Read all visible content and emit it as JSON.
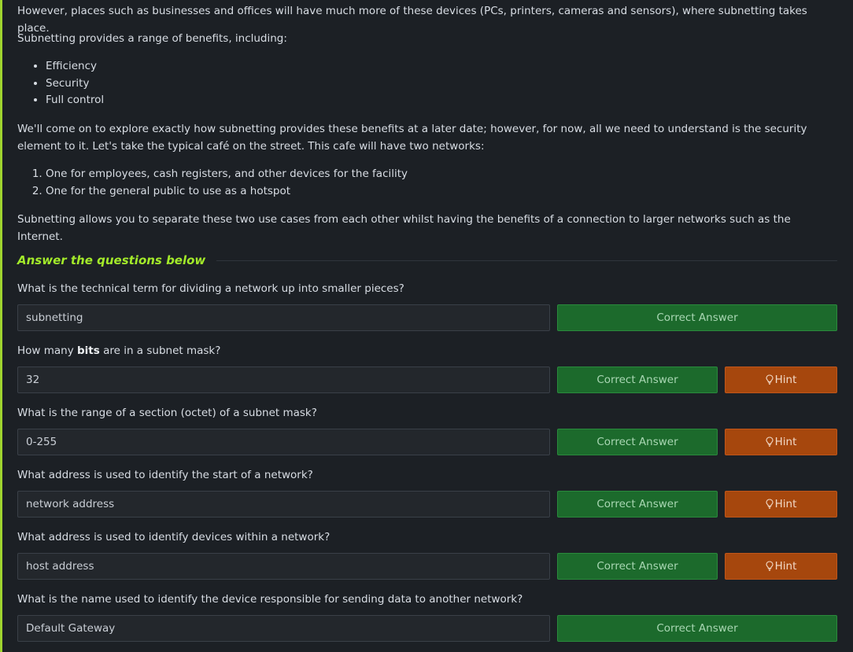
{
  "intro": {
    "p1": "However, places such as businesses and offices will have much more of these devices (PCs, printers, cameras and sensors), where subnetting takes place.",
    "p2": "Subnetting provides a range of benefits, including:",
    "benefits": [
      "Efficiency",
      "Security",
      "Full control"
    ],
    "p3": "We'll come on to explore exactly how subnetting provides these benefits at a later date; however, for now, all we need to understand is the security element to it. Let's take the typical café on the street. This cafe will have two networks:",
    "networks": [
      "One for employees, cash registers, and other devices for the facility",
      "One for the general public to use as a hotspot"
    ],
    "p4": "Subnetting allows you to separate these two use cases from each other whilst having the benefits of a connection to larger networks such as the Internet."
  },
  "answers_section": {
    "title": "Answer the questions below",
    "questions": [
      {
        "question": "What is the technical term for dividing a network up into smaller pieces?",
        "answer": "subnetting",
        "button": "Correct Answer",
        "hint": null
      },
      {
        "question_pre": "How many ",
        "question_bold": "bits",
        "question_post": " are in a subnet mask?",
        "answer": "32",
        "button": "Correct Answer",
        "hint": "Hint"
      },
      {
        "question": "What is the range of a section (octet) of a subnet mask?",
        "answer": "0-255",
        "button": "Correct Answer",
        "hint": "Hint"
      },
      {
        "question": "What address is used to identify the start of a network?",
        "answer": "network address",
        "button": "Correct Answer",
        "hint": "Hint"
      },
      {
        "question": "What address is used to identify devices within a network?",
        "answer": "host address",
        "button": "Correct Answer",
        "hint": "Hint"
      },
      {
        "question": "What is the name used to identify the device responsible for sending data to another network?",
        "answer": "Default Gateway",
        "button": "Correct Answer",
        "hint": null
      }
    ]
  },
  "colors": {
    "accent": "#9fd42f",
    "section_title": "#a3ea2a",
    "correct_bg": "#1c6a2c",
    "hint_bg": "#a6470d",
    "background": "#1c2025"
  },
  "icons": {
    "hint": "lightbulb-icon"
  }
}
